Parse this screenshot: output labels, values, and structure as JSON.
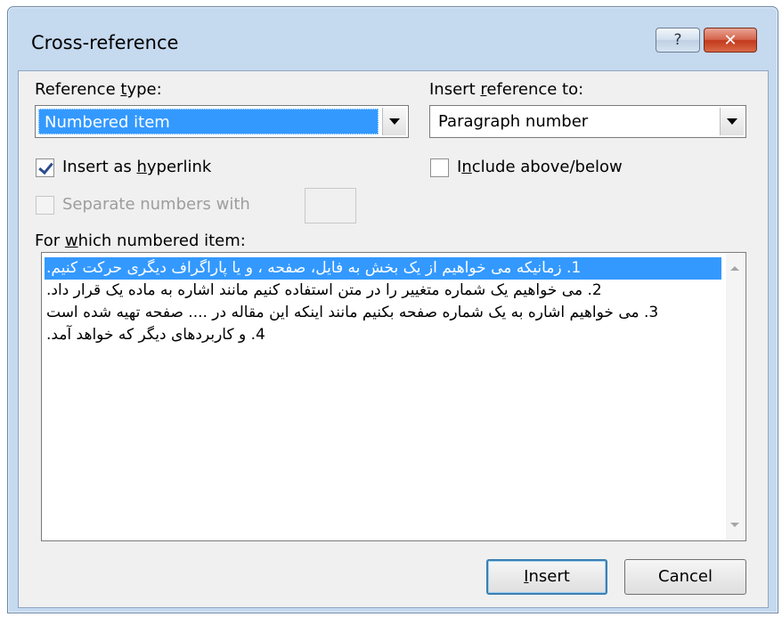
{
  "window": {
    "title": "Cross-reference",
    "help_glyph": "?",
    "close_glyph": "✕"
  },
  "reference_type": {
    "label_pre": "Reference ",
    "label_key": "t",
    "label_post": "ype:",
    "value": "Numbered item"
  },
  "insert_reference_to": {
    "label_pre": "Insert ",
    "label_key": "r",
    "label_post": "eference to:",
    "value": "Paragraph number"
  },
  "insert_as_hyperlink": {
    "label_pre": "Insert as ",
    "label_key": "h",
    "label_post": "yperlink",
    "checked": true
  },
  "include_above_below": {
    "label_pre": "I",
    "label_key": "n",
    "label_post": "clude above/below",
    "checked": false
  },
  "separate_numbers": {
    "label": "Separate numbers with",
    "enabled": false,
    "value": ""
  },
  "items_list": {
    "label_pre": "For ",
    "label_key": "w",
    "label_post": "hich numbered item:",
    "items": [
      "1. زمانیکه می خواهیم از یک بخش به فایل، صفحه ، و یا پاراگراف دیگری حرکت کنیم.",
      "2. می خواهیم یک شماره متغییر را در متن استفاده کنیم مانند اشاره به ماده یک قرار داد.",
      "3. می خواهیم اشاره به یک شماره صفحه بکنیم مانند اینکه این مقاله در .... صفحه تهیه شده است",
      "4. و کاربردهای دیگر که خواهد آمد."
    ],
    "selected_index": 0
  },
  "buttons": {
    "insert_key": "I",
    "insert_rest": "nsert",
    "cancel": "Cancel"
  },
  "colors": {
    "selection": "#3399ff",
    "window_frame": "#c5d9ef",
    "client_bg": "#f0f0f0"
  }
}
